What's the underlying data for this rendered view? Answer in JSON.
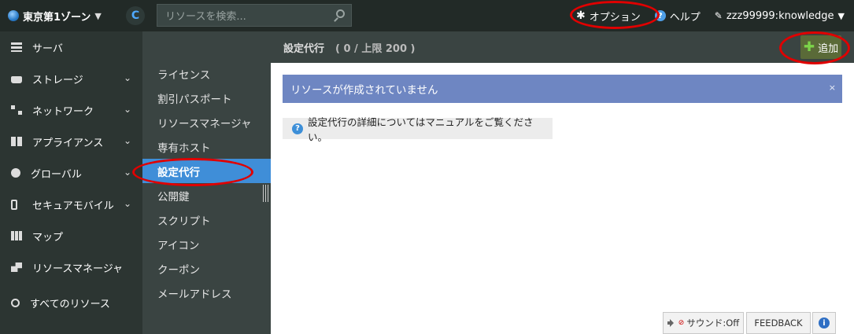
{
  "topbar": {
    "zone_label": "東京第1ゾーン",
    "search_placeholder": "リソースを検索...",
    "options_label": "オプション",
    "help_label": "ヘルプ",
    "account_label": "zzz99999:knowledge"
  },
  "leftnav": {
    "items": [
      {
        "label": "サーバ",
        "icon": "server-icon"
      },
      {
        "label": "ストレージ",
        "icon": "storage-icon"
      },
      {
        "label": "ネットワーク",
        "icon": "network-icon"
      },
      {
        "label": "アプライアンス",
        "icon": "appliance-icon"
      },
      {
        "label": "グローバル",
        "icon": "globe-icon"
      },
      {
        "label": "セキュアモバイル",
        "icon": "mobile-icon"
      },
      {
        "label": "マップ",
        "icon": "map-icon"
      },
      {
        "label": "リソースマネージャ",
        "icon": "resource-manager-icon"
      },
      {
        "label": "すべてのリソース",
        "icon": "search-icon"
      }
    ]
  },
  "subnav": {
    "items": [
      {
        "label": "ライセンス"
      },
      {
        "label": "割引パスポート"
      },
      {
        "label": "リソースマネージャ"
      },
      {
        "label": "専有ホスト"
      },
      {
        "label": "設定代行",
        "active": true
      },
      {
        "label": "公開鍵"
      },
      {
        "label": "スクリプト"
      },
      {
        "label": "アイコン"
      },
      {
        "label": "クーポン"
      },
      {
        "label": "メールアドレス"
      }
    ]
  },
  "main": {
    "title": "設定代行",
    "count": "( 0 / 上限 200 )",
    "add_label": "追加",
    "alert_text": "リソースが作成されていません",
    "alert_close": "×",
    "info_text": "設定代行の詳細についてはマニュアルをご覧ください。"
  },
  "footer": {
    "sound_label": "サウンド:Off",
    "feedback_label": "FEEDBACK"
  },
  "colors": {
    "topbar_bg": "#222a27",
    "active_item": "#3f8ed8",
    "alert_bg": "#6e86c2",
    "annotation_ring": "#e00000"
  }
}
